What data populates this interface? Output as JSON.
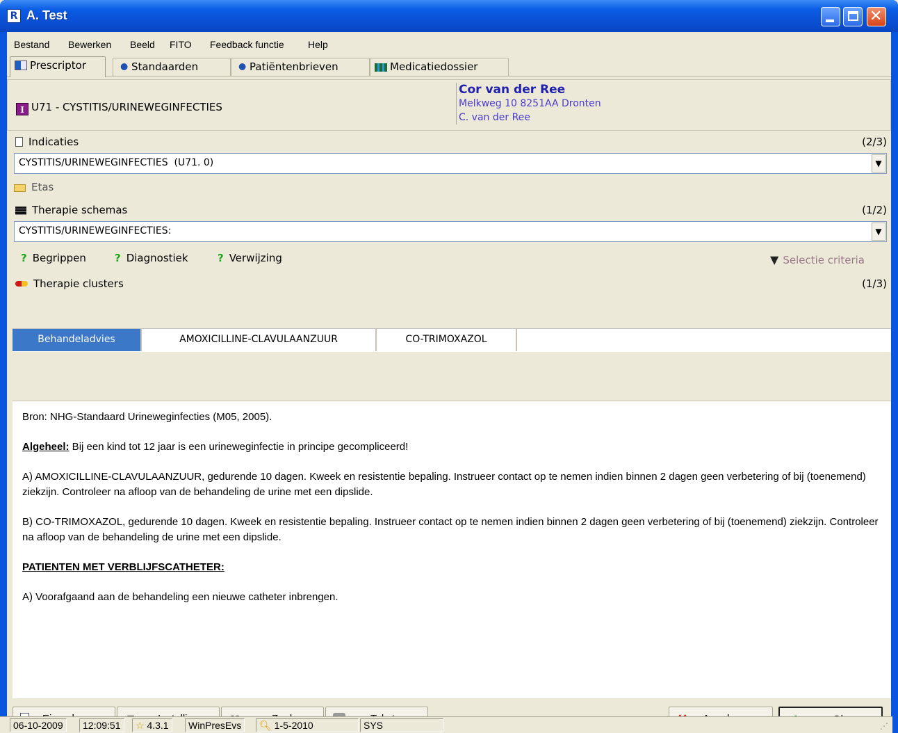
{
  "window": {
    "title": "A. Test",
    "app_icon": "R"
  },
  "menu": [
    "Bestand",
    "Bewerken",
    "Beeld",
    "FITO",
    "Feedback functie",
    "Help"
  ],
  "tabs": [
    {
      "label": "Prescriptor",
      "icon": "prescriptor-icon",
      "active": true
    },
    {
      "label": "Standaarden",
      "icon": "standaarden-icon",
      "active": false
    },
    {
      "label": "Patiëntenbrieven",
      "icon": "patientenbrieven-icon",
      "active": false
    },
    {
      "label": "Medicatiedossier",
      "icon": "medicatiedossier-icon",
      "active": false
    }
  ],
  "header": {
    "diagnosis_badge": "I",
    "diagnosis": "U71 - CYSTITIS/URINEWEGINFECTIES",
    "patient_name": "Cor van der Ree",
    "patient_address": "Melkweg 10 8251AA Dronten",
    "patient_doctor": "C. van der Ree"
  },
  "indicaties": {
    "label": "Indicaties",
    "count": "(2/3)",
    "value": "CYSTITIS/URINEWEGINFECTIES  (U71. 0)"
  },
  "etas": {
    "label": "Etas"
  },
  "therapie_schemas": {
    "label": "Therapie schemas",
    "count": "(1/2)",
    "value": "CYSTITIS/URINEWEGINFECTIES:"
  },
  "links": {
    "begrippen": "Begrippen",
    "diagnostiek": "Diagnostiek",
    "verwijzing": "Verwijzing",
    "selectie": "Selectie criteria"
  },
  "therapie_clusters": {
    "label": "Therapie clusters",
    "count": "(1/3)"
  },
  "cluster_tabs": [
    "Behandeladvies",
    "AMOXICILLINE-CLAVULAANZUUR",
    "CO-TRIMOXAZOL"
  ],
  "content": {
    "bron": "Bron: NHG-Standaard Urineweginfecties (M05, 2005).",
    "algeheel_label": "Algeheel:",
    "algeheel_text": " Bij een kind tot 12 jaar is een urineweginfectie in principe gecompliceerd!",
    "a_text": "A) AMOXICILLINE-CLAVULAANZUUR, gedurende 10 dagen. Kweek en resistentie bepaling. Instrueer contact op te nemen indien binnen 2 dagen geen verbetering of bij (toenemend) ziekzijn. Controleer na afloop van de behandeling de urine met een dipslide.",
    "b_text": "B) CO-TRIMOXAZOL, gedurende 10 dagen. Kweek en resistentie bepaling. Instrueer contact op te nemen indien binnen 2 dagen geen verbetering of bij (toenemend) ziekzijn. Controleer na afloop van de behandeling de urine met een dipslide.",
    "catheter_heading": "PATIENTEN MET VERBLIJFSCATHETER:",
    "catheter_text": "A) Voorafgaand aan de behandeling een nieuwe catheter inbrengen."
  },
  "buttons": {
    "eigen_keuze": "Eigen keuze",
    "instelling": "Instelling",
    "zoek": "Zoek",
    "teksten": "Teksten",
    "annuleren": "Annuleren",
    "ok": "Ok"
  },
  "status": {
    "date": "06-10-2009",
    "time": "12:09:51",
    "version": "4.3.1",
    "module": "WinPresEvs",
    "key_date": "1-5-2010",
    "user": "SYS"
  },
  "colors": {
    "titlebar": "#0A55E0",
    "active_cluster": "#3C78C8",
    "patient_text": "#2020b0",
    "help_icon": "#1aa81a",
    "cancel_x": "#d01010"
  }
}
